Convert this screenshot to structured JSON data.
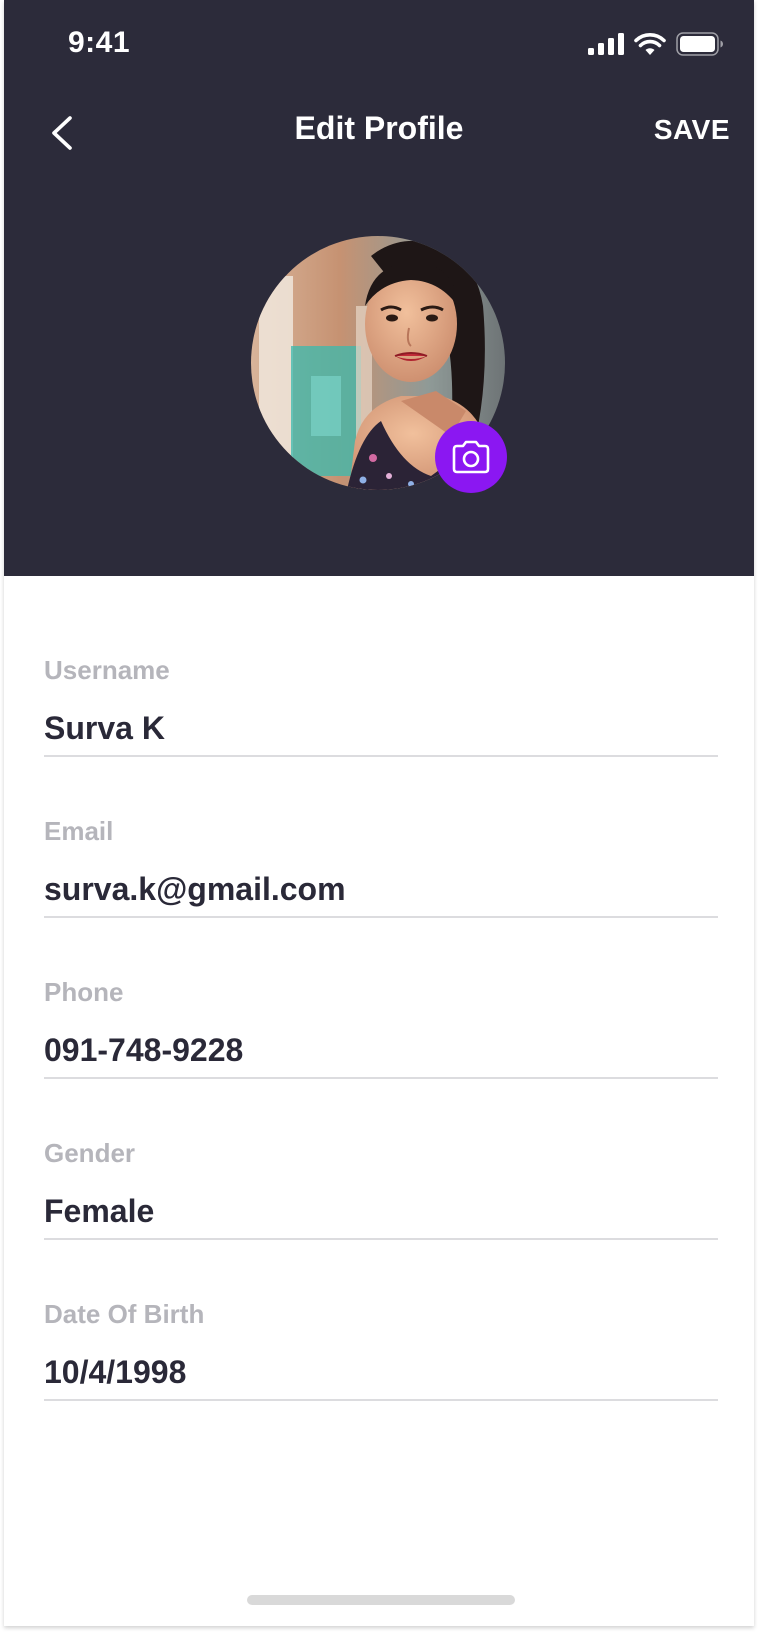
{
  "status_bar": {
    "time": "9:41"
  },
  "nav": {
    "title": "Edit Profile",
    "save_label": "SAVE",
    "back_icon": "chevron-left-icon"
  },
  "profile": {
    "photo_icon": "camera-icon",
    "accent_color": "#8b17f2",
    "header_color": "#2c2b3a"
  },
  "fields": [
    {
      "label": "Username",
      "value": "Surva K"
    },
    {
      "label": "Email",
      "value": "surva.k@gmail.com"
    },
    {
      "label": "Phone",
      "value": "091-748-9228"
    },
    {
      "label": "Gender",
      "value": "Female"
    },
    {
      "label": "Date Of Birth",
      "value": "10/4/1998"
    }
  ]
}
